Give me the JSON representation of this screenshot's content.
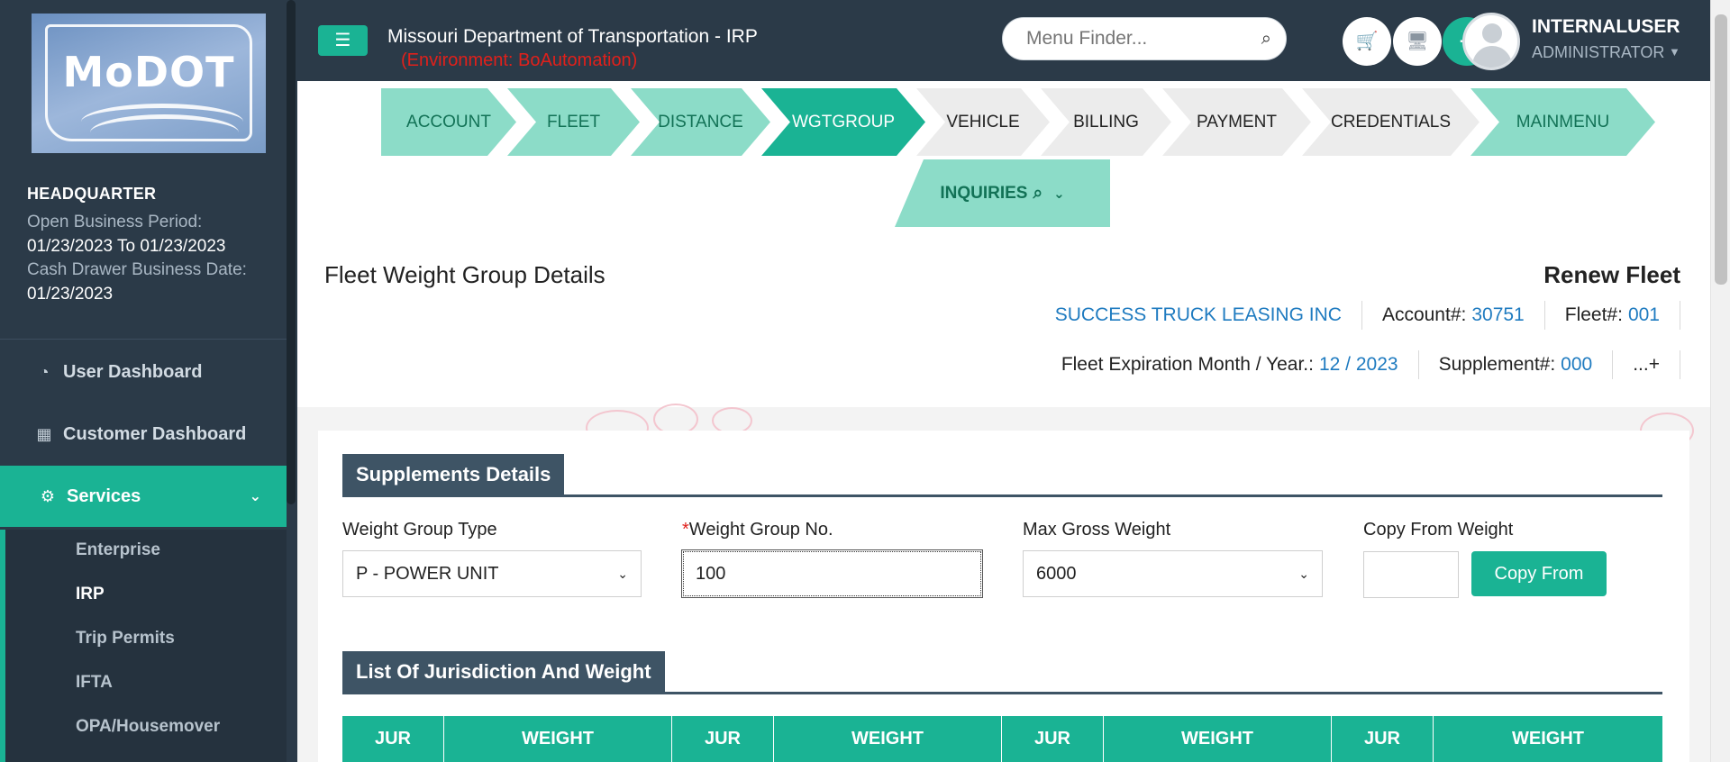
{
  "sidebar": {
    "logo_text": "MoDOT",
    "hq_title": "HEADQUARTER",
    "open_period_label": "Open Business Period:",
    "open_period_value": "01/23/2023 To 01/23/2023",
    "cash_drawer_label": "Cash Drawer Business Date:",
    "cash_drawer_value": "01/23/2023",
    "nav": [
      {
        "label": "User Dashboard",
        "icon": "dashboard-icon"
      },
      {
        "label": "Customer Dashboard",
        "icon": "grid-icon"
      },
      {
        "label": "Services",
        "icon": "gears-icon"
      }
    ],
    "sub_items": [
      "Enterprise",
      "IRP",
      "Trip Permits",
      "IFTA",
      "OPA/Housemover"
    ],
    "active_sub": "IRP"
  },
  "topbar": {
    "title": "Missouri Department of Transportation - IRP",
    "environment": "(Environment: BoAutomation)",
    "menu_finder_placeholder": "Menu Finder...",
    "user_name": "INTERNALUSER",
    "user_role": "ADMINISTRATOR"
  },
  "wizard": {
    "steps": [
      {
        "label": "ACCOUNT",
        "state": "done"
      },
      {
        "label": "FLEET",
        "state": "done"
      },
      {
        "label": "DISTANCE",
        "state": "done"
      },
      {
        "label": "WGTGROUP",
        "state": "current"
      },
      {
        "label": "VEHICLE",
        "state": "todo"
      },
      {
        "label": "BILLING",
        "state": "todo"
      },
      {
        "label": "PAYMENT",
        "state": "todo"
      },
      {
        "label": "CREDENTIALS",
        "state": "todo"
      },
      {
        "label": "MAINMENU",
        "state": "done"
      }
    ],
    "inquiries": "INQUIRIES"
  },
  "page": {
    "title": "Fleet Weight Group Details",
    "mode": "Renew Fleet",
    "company": "SUCCESS TRUCK LEASING INC",
    "account_label": "Account#:",
    "account_value": "30751",
    "fleet_label": "Fleet#:",
    "fleet_value": "001",
    "expiration_label": "Fleet Expiration Month / Year.:",
    "expiration_value": "12 / 2023",
    "supplement_label": "Supplement#:",
    "supplement_value": "000",
    "more": "...+"
  },
  "supplements": {
    "heading": "Supplements Details",
    "weight_group_type_label": "Weight Group Type",
    "weight_group_type_value": "P - POWER UNIT",
    "weight_group_no_label": "Weight Group No.",
    "weight_group_no_value": "100",
    "max_gross_label": "Max Gross Weight",
    "max_gross_value": "6000",
    "copy_from_label": "Copy From Weight",
    "copy_from_value": "",
    "copy_button": "Copy From"
  },
  "jurisdiction": {
    "heading": "List Of Jurisdiction And Weight",
    "columns": [
      "JUR",
      "WEIGHT",
      "JUR",
      "WEIGHT",
      "JUR",
      "WEIGHT",
      "JUR",
      "WEIGHT"
    ]
  },
  "colors": {
    "accent": "#1ab394",
    "sidebar_bg": "#2b3a48",
    "environment_text": "#e0201b",
    "link": "#1f7bc0"
  }
}
